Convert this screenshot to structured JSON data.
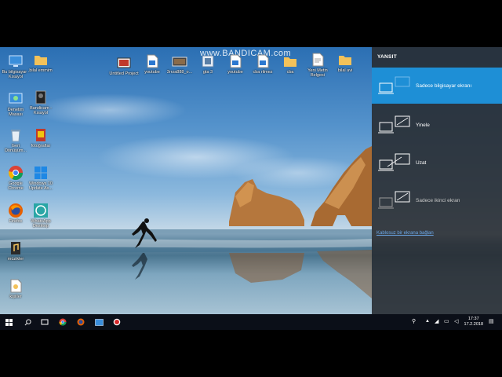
{
  "watermark": "www.BANDICAM.com",
  "desktop_icons": [
    {
      "label": "Bu bilgisayar - Kısayol",
      "icon": "this-pc-icon"
    },
    {
      "label": "bilal emmim",
      "icon": "folder-icon"
    },
    {
      "label": "Untitled Project",
      "icon": "video-project-icon"
    },
    {
      "label": "youtube",
      "icon": "document-icon"
    },
    {
      "label": "3rrza888_o...",
      "icon": "video-file-icon"
    },
    {
      "label": "gta 3",
      "icon": "application-icon"
    },
    {
      "label": "youtube",
      "icon": "document-icon"
    },
    {
      "label": "cba rilmez",
      "icon": "document-icon"
    },
    {
      "label": "cba",
      "icon": "folder-icon"
    },
    {
      "label": "Yeni Metin Belgesi",
      "icon": "text-file-icon"
    },
    {
      "label": "bilal avi",
      "icon": "folder-icon"
    },
    {
      "label": "Denetim Masası",
      "icon": "control-panel-icon"
    },
    {
      "label": "Bandicam - Kısayol",
      "icon": "bandicam-icon"
    },
    {
      "label": "Geri Dönüşüm...",
      "icon": "recycle-bin-icon"
    },
    {
      "label": "fotoğraflar",
      "icon": "photos-icon"
    },
    {
      "label": "Google Chrome",
      "icon": "chrome-icon"
    },
    {
      "label": "Windows 10 Update As...",
      "icon": "windows-icon"
    },
    {
      "label": "Firefox",
      "icon": "firefox-icon"
    },
    {
      "label": "WhatsApp Desktop",
      "icon": "whatsapp-icon"
    },
    {
      "label": "müzikler",
      "icon": "music-folder-icon"
    },
    {
      "label": "kişiller",
      "icon": "document-icon"
    }
  ],
  "project_panel": {
    "title": "YANSIT",
    "options": [
      {
        "label": "Sadece bilgisayar ekranı",
        "selected": true
      },
      {
        "label": "Yinele",
        "selected": false
      },
      {
        "label": "Uzat",
        "selected": false
      },
      {
        "label": "Sadece ikinci ekran",
        "selected": false
      }
    ],
    "wireless_link": "Kablosuz bir ekrana bağlan"
  },
  "taskbar": {
    "items": [
      "start-button",
      "search-icon",
      "task-view-icon",
      "chrome-icon",
      "firefox-icon",
      "file-explorer-icon",
      "bandicam-icon"
    ],
    "time": "17:37",
    "date": "17.2.2018"
  },
  "colors": {
    "accent": "#1e8fd6",
    "panel_bg": "#282c32",
    "taskbar_bg": "#0b0f18",
    "link": "#6aa6e6"
  }
}
